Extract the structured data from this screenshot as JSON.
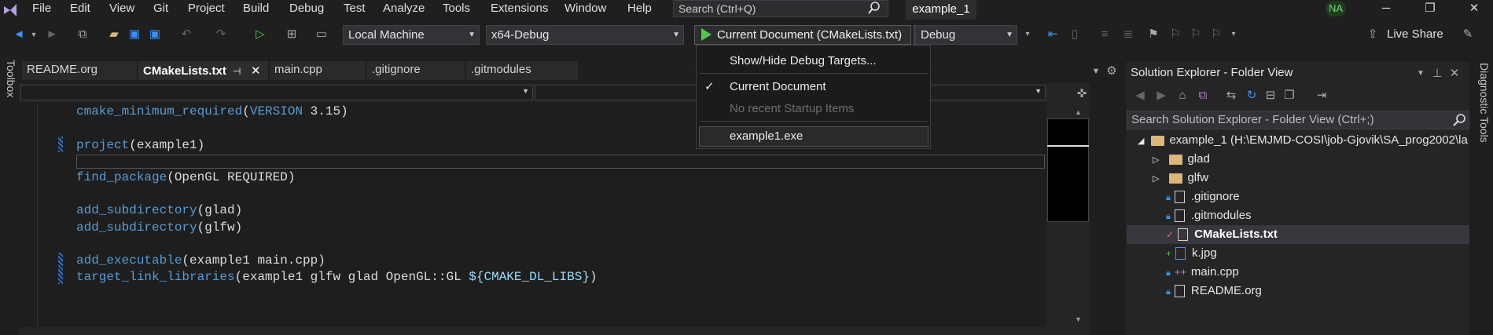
{
  "menubar": {
    "items": [
      "File",
      "Edit",
      "View",
      "Git",
      "Project",
      "Build",
      "Debug",
      "Test",
      "Analyze",
      "Tools",
      "Extensions",
      "Window",
      "Help"
    ],
    "search_placeholder": "Search (Ctrl+Q)",
    "solution_name": "example_1",
    "avatar_initials": "NA"
  },
  "toolbar": {
    "target": "Local Machine",
    "config": "x64-Debug",
    "run_label": "Current Document (CMakeLists.txt)",
    "debug_mode": "Debug",
    "live_share": "Live Share"
  },
  "left_strip": {
    "label": "Toolbox"
  },
  "tabs": [
    {
      "label": "README.org"
    },
    {
      "label": "CMakeLists.txt",
      "active": true
    },
    {
      "label": "main.cpp"
    },
    {
      "label": ".gitignore"
    },
    {
      "label": ".gitmodules"
    }
  ],
  "code": {
    "l1": {
      "fn": "cmake_minimum_required",
      "a": "(",
      "kw": "VERSION",
      "b": " 3.15)"
    },
    "l2": {
      "fn": "project",
      "a": "(example1)"
    },
    "l3": {
      "fn": "find_package",
      "a": "(OpenGL REQUIRED)"
    },
    "l4": {
      "fn": "add_subdirectory",
      "a": "(glad)"
    },
    "l5": {
      "fn": "add_subdirectory",
      "a": "(glfw)"
    },
    "l6": {
      "fn": "add_executable",
      "a": "(example1 main.cpp)"
    },
    "l7": {
      "fn": "target_link_libraries",
      "a": "(example1 glfw glad OpenGL::GL ",
      "v": "${CMAKE_DL_LIBS}",
      "b": ")"
    }
  },
  "run_menu": {
    "show_hide": "Show/Hide Debug Targets...",
    "current": "Current Document",
    "check": "✓",
    "no_recent": "No recent Startup Items",
    "exe": "example1.exe"
  },
  "solution_explorer": {
    "title": "Solution Explorer - Folder View",
    "search": "Search Solution Explorer - Folder View (Ctrl+;)",
    "root": "example_1 (H:\\EMJMD-COSI\\job-Gjovik\\SA_prog2002\\la",
    "items": [
      "glad",
      "glfw",
      ".gitignore",
      ".gitmodules",
      "CMakeLists.txt",
      "k.jpg",
      "main.cpp",
      "README.org"
    ]
  },
  "right_strip": {
    "label": "Diagnostic Tools"
  },
  "colors": {
    "accent": "#569cd6",
    "run_green": "#4ec94e",
    "folder": "#dcb67a"
  }
}
